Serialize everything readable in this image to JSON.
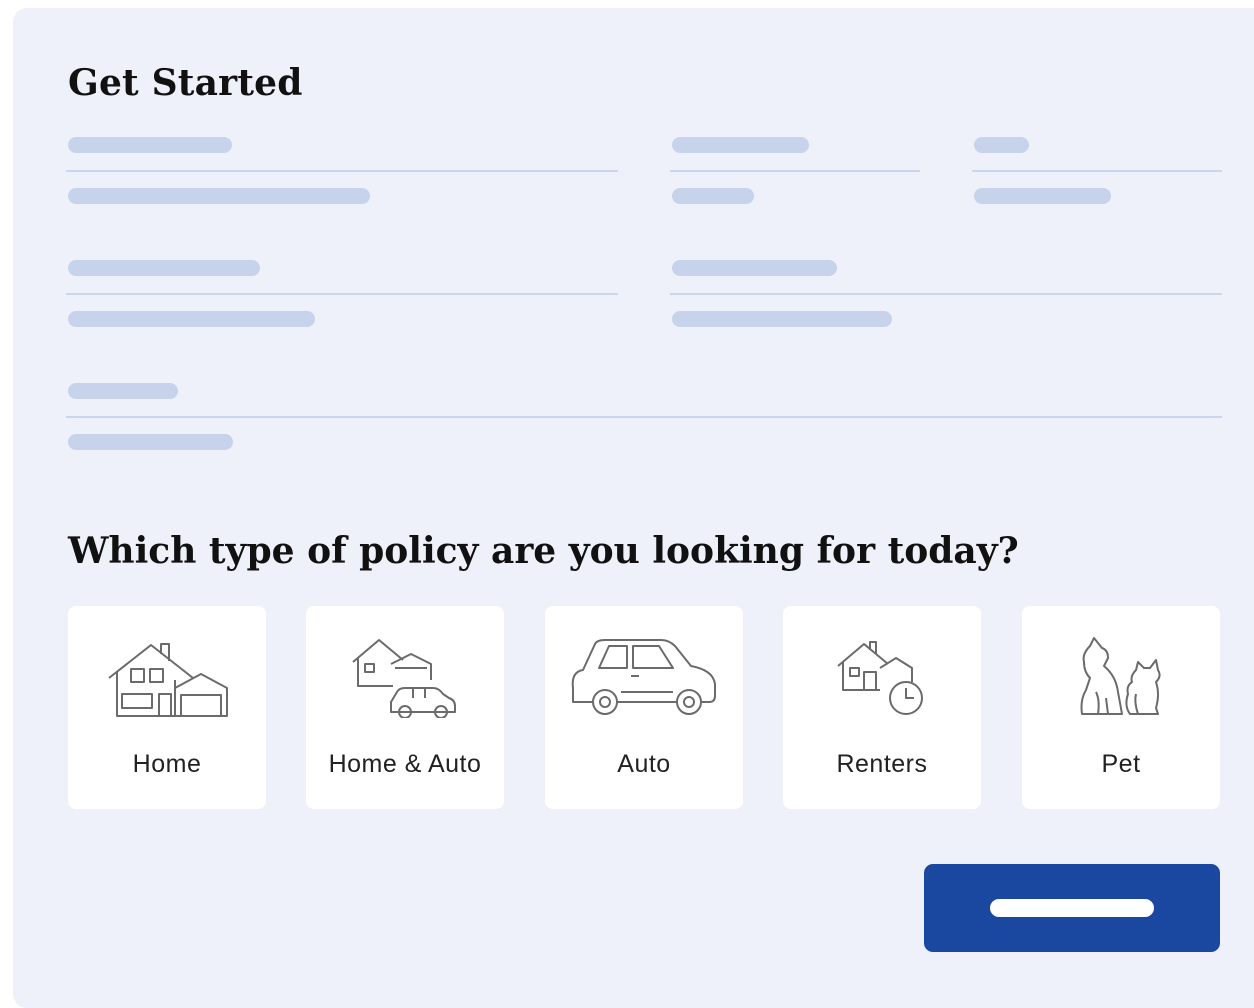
{
  "form": {
    "title": "Get Started",
    "question": "Which type of policy are you looking for today?"
  },
  "policy_options": [
    {
      "label": "Home",
      "icon": "house-icon"
    },
    {
      "label": "Home & Auto",
      "icon": "house-car-icon"
    },
    {
      "label": "Auto",
      "icon": "car-icon"
    },
    {
      "label": "Renters",
      "icon": "house-clock-icon"
    },
    {
      "label": "Pet",
      "icon": "dog-cat-icon"
    }
  ],
  "colors": {
    "card_background": "#eef1f9",
    "placeholder": "#c6d3ea",
    "primary_button": "#1a47a0",
    "option_background": "#ffffff"
  }
}
